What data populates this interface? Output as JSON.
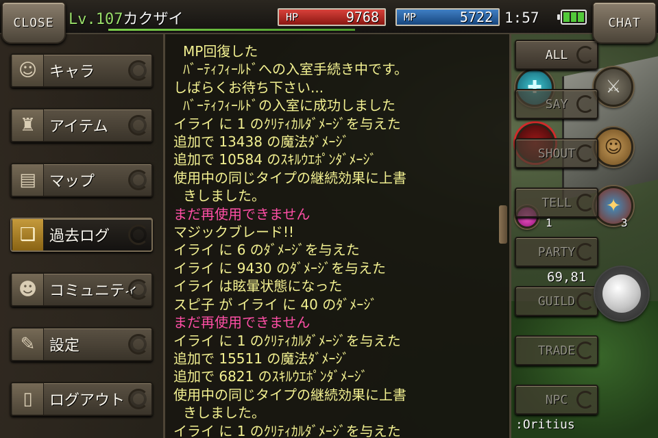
{
  "top_bar": {
    "close_label": "CLOSE",
    "chat_label": "CHAT",
    "level_prefix": "Lv.",
    "level": "107",
    "character_name": "カクザイ",
    "hp_label": "HP",
    "hp_value": "9768",
    "mp_label": "MP",
    "mp_value": "5722",
    "clock": "1:57",
    "battery_icon": "battery-icon"
  },
  "menu": {
    "items": [
      {
        "label": "キャラ",
        "icon": "character-icon"
      },
      {
        "label": "アイテム",
        "icon": "item-bag-icon"
      },
      {
        "label": "マップ",
        "icon": "map-icon"
      },
      {
        "label": "過去ログ",
        "icon": "book-icon"
      },
      {
        "label": "コミュニティ",
        "icon": "community-icon"
      },
      {
        "label": "設定",
        "icon": "settings-icon"
      },
      {
        "label": "ログアウト",
        "icon": "door-icon"
      }
    ],
    "active_index": 3
  },
  "log": {
    "lines": [
      {
        "text": "MP回復した",
        "color": "yellow",
        "indent": true
      },
      {
        "text": " ﾊﾞｰﾃｨﾌｨｰﾙﾄﾞへの入室手続き中です。",
        "color": "yellow",
        "indent": true
      },
      {
        "text": "しばらくお待ち下さい...",
        "color": "yellow"
      },
      {
        "text": " ﾊﾞｰﾃｨﾌｨｰﾙﾄﾞの入室に成功しました",
        "color": "yellow",
        "indent": true
      },
      {
        "text": "イライ に 1 のｸﾘﾃｨｶﾙﾀﾞﾒｰｼﾞを与えた",
        "color": "yellow"
      },
      {
        "text": "追加で 13438 の魔法ﾀﾞﾒｰｼﾞ",
        "color": "yellow"
      },
      {
        "text": "追加で 10584 のｽｷﾙｳｴﾎﾟﾝﾀﾞﾒｰｼﾞ",
        "color": "yellow"
      },
      {
        "text": "使用中の同じタイプの継続効果に上書",
        "color": "yellow"
      },
      {
        "text": "きしました。",
        "color": "yellow",
        "indent": true
      },
      {
        "text": "まだ再使用できません",
        "color": "pink"
      },
      {
        "text": "マジックブレード!!",
        "color": "yellow"
      },
      {
        "text": "イライ に 6 のﾀﾞﾒｰｼﾞを与えた",
        "color": "yellow"
      },
      {
        "text": "イライ に 9430 のﾀﾞﾒｰｼﾞを与えた",
        "color": "yellow"
      },
      {
        "text": "イライ は眩暈状態になった",
        "color": "yellow"
      },
      {
        "text": "スピ子 が イライ に 40 のﾀﾞﾒｰｼﾞ",
        "color": "yellow"
      },
      {
        "text": "まだ再使用できません",
        "color": "pink"
      },
      {
        "text": "イライ に 1 のｸﾘﾃｨｶﾙﾀﾞﾒｰｼﾞを与えた",
        "color": "yellow"
      },
      {
        "text": "追加で 15511 の魔法ﾀﾞﾒｰｼﾞ",
        "color": "yellow"
      },
      {
        "text": "追加で 6821 のｽｷﾙｳｴﾎﾟﾝﾀﾞﾒｰｼﾞ",
        "color": "yellow"
      },
      {
        "text": "使用中の同じタイプの継続効果に上書",
        "color": "yellow"
      },
      {
        "text": "きしました。",
        "color": "yellow",
        "indent": true
      },
      {
        "text": "イライ に 1 のｸﾘﾃｨｶﾙﾀﾞﾒｰｼﾞを与えた",
        "color": "yellow"
      }
    ]
  },
  "channels": {
    "all": "ALL",
    "say": "SAY",
    "shout": "SHOUT",
    "tell": "TELL",
    "party": "PARTY",
    "guild": "GUILD",
    "trade": "TRADE",
    "npc": "NPC"
  },
  "hud": {
    "skill_count_left": "1",
    "skill_count_right": "3",
    "coords": "69,81",
    "target_name": ":Oritius"
  },
  "colors": {
    "log_yellow": "#f3f191",
    "log_pink": "#ff4fa6",
    "hp_red": "#d8413a",
    "mp_blue": "#3f7fc4",
    "level_green": "#9adf6a"
  }
}
